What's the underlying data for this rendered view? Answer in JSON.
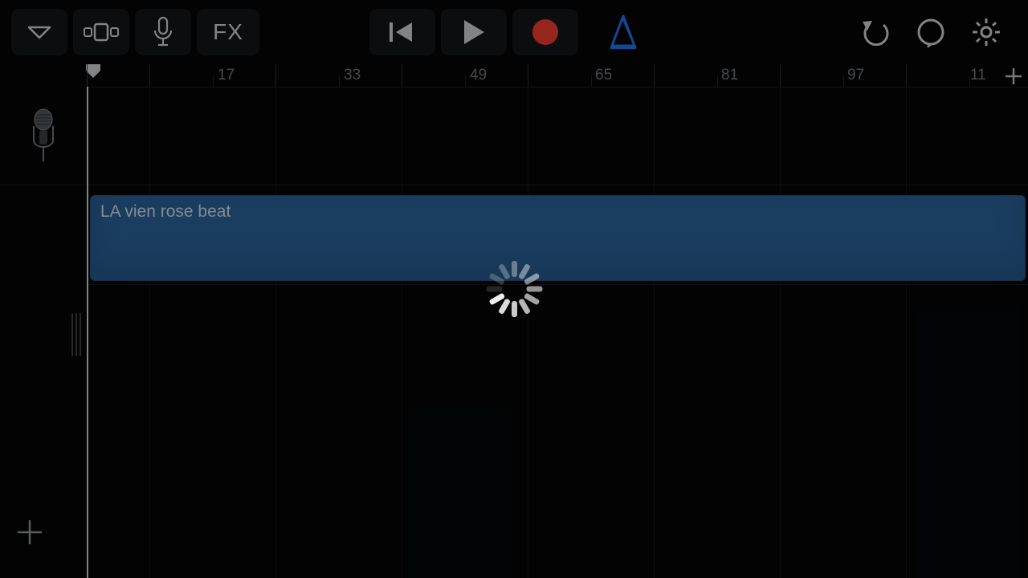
{
  "toolbar": {
    "fx_label": "FX"
  },
  "ruler": {
    "labels": [
      {
        "pos": 163,
        "text": "17"
      },
      {
        "pos": 320,
        "text": "33"
      },
      {
        "pos": 477,
        "text": "49"
      },
      {
        "pos": 633,
        "text": "65"
      },
      {
        "pos": 790,
        "text": "81"
      },
      {
        "pos": 947,
        "text": "97"
      },
      {
        "pos": 1100,
        "text": "11"
      }
    ]
  },
  "region": {
    "name": "LA vien rose beat"
  },
  "colors": {
    "accent_record": "#e43b2f",
    "metronome": "#1e6fe0",
    "region": "#2a5e94"
  }
}
